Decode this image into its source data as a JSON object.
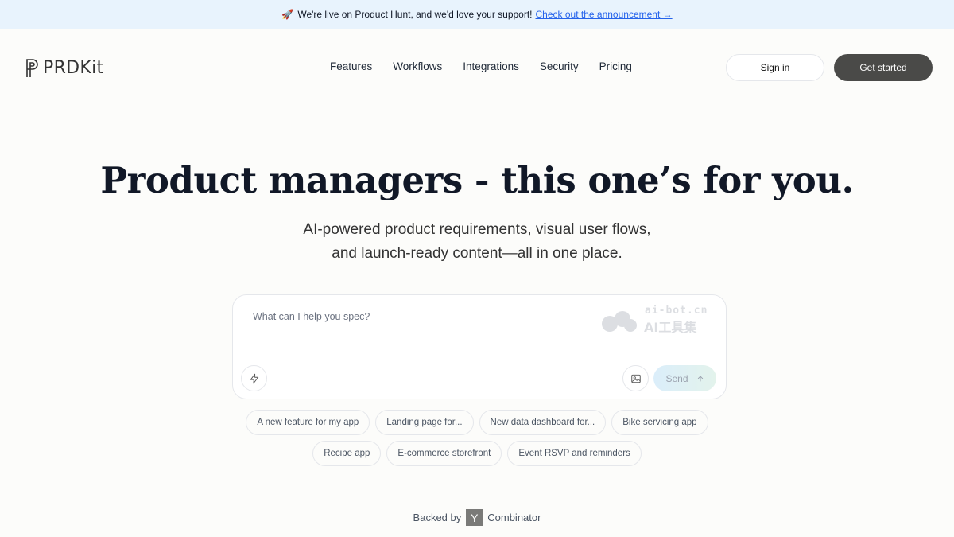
{
  "announcement": {
    "text": "We're live on Product Hunt, and we'd love your support!",
    "link": "Check out the announcement →"
  },
  "header": {
    "brand": "PRDKit",
    "nav": [
      "Features",
      "Workflows",
      "Integrations",
      "Security",
      "Pricing"
    ],
    "signin_label": "Sign in",
    "cta_label": "Get started"
  },
  "hero": {
    "title": "Product managers - this one’s for you.",
    "subtitle_line1": "AI-powered product requirements, visual user flows,",
    "subtitle_line2": "and launch-ready content—all in one place."
  },
  "prompt": {
    "placeholder": "What can I help you spec?",
    "send_label": "Send",
    "watermark_top": "ai-bot.cn",
    "watermark_bottom": "AI工具集"
  },
  "suggestions": {
    "row1": [
      "A new feature for my app",
      "Landing page for...",
      "New data dashboard for...",
      "Bike servicing app"
    ],
    "row2": [
      "Recipe app",
      "E-commerce storefront",
      "Event RSVP and reminders"
    ]
  },
  "footer": {
    "backed_prefix": "Backed by",
    "yc_letter": "Y",
    "backed_suffix": "Combinator"
  },
  "colors": {
    "announcement_bg": "#e8f3fd",
    "page_bg": "#fcfcfa",
    "cta_bg": "#4a4a48",
    "link": "#2563eb"
  }
}
